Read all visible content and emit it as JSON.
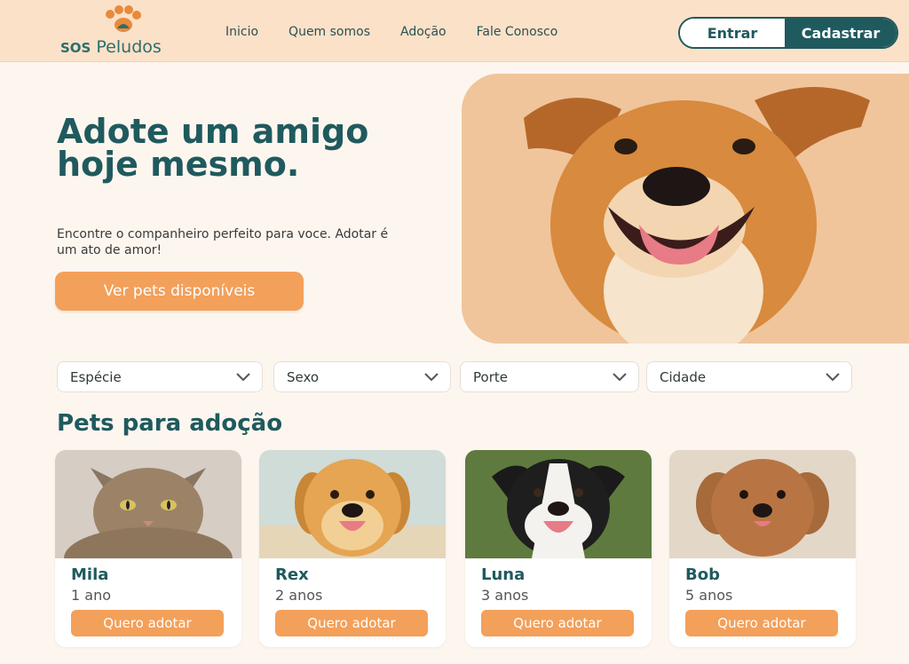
{
  "brand": {
    "sos": "SOS",
    "name": "Peludos"
  },
  "nav": {
    "items": [
      "Inicio",
      "Quem somos",
      "Adoção",
      "Fale Conosco"
    ]
  },
  "auth": {
    "login": "Entrar",
    "signup": "Cadastrar"
  },
  "hero": {
    "title": "Adote um amigo hoje mesmo.",
    "subtitle": "Encontre o companheiro perfeito para voce. Adotar é um ato de amor!",
    "cta": "Ver pets disponíveis"
  },
  "filters": [
    "Espécie",
    "Sexo",
    "Porte",
    "Cidade"
  ],
  "section": {
    "title": "Pets para adoção"
  },
  "pets": [
    {
      "name": "Mila",
      "age": "1 ano",
      "button": "Quero adotar"
    },
    {
      "name": "Rex",
      "age": "2 anos",
      "button": "Quero adotar"
    },
    {
      "name": "Luna",
      "age": "3 anos",
      "button": "Quero adotar"
    },
    {
      "name": "Bob",
      "age": "5 anos",
      "button": "Quero adotar"
    }
  ],
  "colors": {
    "primary": "#1f5a5e",
    "accent": "#f3a05a",
    "header_bg": "#fbe1c8",
    "page_bg": "#fdf6ef"
  },
  "icons": {
    "logo": "paw-icon",
    "filter_dropdown": "chevron-down-icon"
  }
}
